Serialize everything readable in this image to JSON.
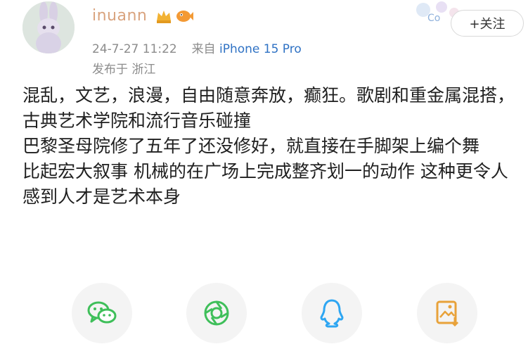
{
  "user": {
    "name": "inuann",
    "timestamp": "24-7-27 11:22",
    "source_prefix": "来自",
    "device": "iPhone 15 Pro",
    "location": "发布于 浙江",
    "follow_label": "+关注",
    "avatar_icon": "bunny-avatar-icon",
    "badges": [
      "crown-badge-icon",
      "fish-badge-icon"
    ]
  },
  "post": {
    "lines": [
      "混乱，文艺，浪漫，自由随意奔放，癫狂。歌剧和重金属混搭，古典艺术学院和流行音乐碰撞",
      "巴黎圣母院修了五年了还没修好，就直接在手脚架上编个舞",
      "比起宏大叙事 机械的在广场上完成整齐划一的动作 这种更令人感到人才是艺术本身"
    ]
  },
  "share": {
    "buttons": [
      {
        "name": "wechat-share-button",
        "icon": "wechat-icon",
        "color": "#3fbf5a"
      },
      {
        "name": "moments-share-button",
        "icon": "moments-icon",
        "color": "#3fbf5a"
      },
      {
        "name": "qq-share-button",
        "icon": "qq-icon",
        "color": "#2ea6f2"
      },
      {
        "name": "save-image-button",
        "icon": "save-image-icon",
        "color": "#e8a23a"
      }
    ]
  },
  "colors": {
    "username": "#d9a37e",
    "device_link": "#2f72c4",
    "meta": "#8c8c8c"
  }
}
